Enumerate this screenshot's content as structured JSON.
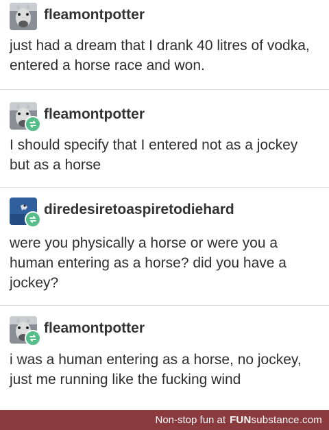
{
  "posts": [
    {
      "username": "fleamontpotter",
      "avatar_icon": "horse-avatar-icon",
      "reblogged": false,
      "text": "just had a dream that I drank 40 litres of vodka, entered a horse race and won."
    },
    {
      "username": "fleamontpotter",
      "avatar_icon": "horse-avatar-icon",
      "reblogged": true,
      "text": "I should specify that I entered not as a jockey but as a horse"
    },
    {
      "username": "diredesiretoaspiretodiehard",
      "avatar_icon": "blue-avatar-icon",
      "reblogged": true,
      "text": "were you physically a horse or were you a human entering as a horse? did you have a jockey?"
    },
    {
      "username": "fleamontpotter",
      "avatar_icon": "horse-avatar-icon",
      "reblogged": true,
      "text": "i was a human entering as a horse, no jockey, just me running like the fucking wind"
    }
  ],
  "footer": {
    "tagline": "Non-stop fun at",
    "brand_bold": "FUN",
    "brand_light": "substance",
    "brand_suffix": ".com",
    "background": "#8b3a3e"
  },
  "colors": {
    "reblog_badge": "#56bc8a",
    "divider": "#e2e2e2"
  }
}
